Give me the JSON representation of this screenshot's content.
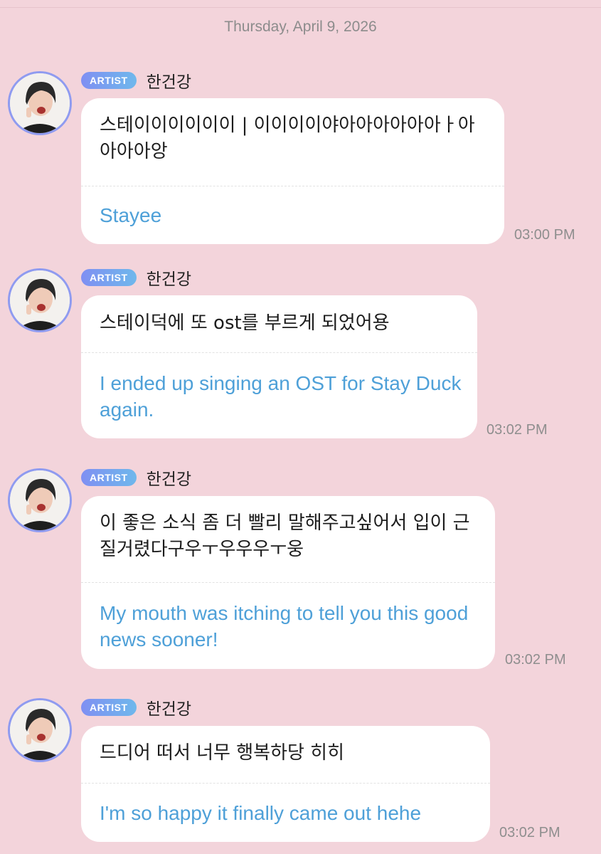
{
  "date_header": "Thursday, April 9, 2026",
  "messages": [
    {
      "badge": "ARTIST",
      "sender": "한건강",
      "original": "스테이이이이이이 | 이이이이야아아아아아아ㅏ아아아아앙",
      "translation": "Stayee",
      "time": "03:00 PM",
      "avatar_icon": "artist-avatar-icon"
    },
    {
      "badge": "ARTIST",
      "sender": "한건강",
      "original": "스테이덕에 또 ost를 부르게 되었어용",
      "translation": "I ended up singing an OST for Stay Duck again.",
      "time": "03:02 PM",
      "avatar_icon": "artist-avatar-icon"
    },
    {
      "badge": "ARTIST",
      "sender": "한건강",
      "original": " 이 좋은 소식 좀 더 빨리 말해주고싶어서 입이 근질거렸다구우ㅜ우우우ㅜ웅",
      "translation": "My mouth was itching to tell you this good news sooner!",
      "time": "03:02 PM",
      "avatar_icon": "artist-avatar-icon"
    },
    {
      "badge": "ARTIST",
      "sender": "한건강",
      "original": "드디어 떠서 너무 행복하당 히히",
      "translation": "I'm so happy it finally came out hehe",
      "time": "03:02 PM",
      "avatar_icon": "artist-avatar-icon"
    }
  ],
  "colors": {
    "background": "#f3d4db",
    "bubble": "#ffffff",
    "translation_text": "#4ea0d8",
    "badge_start": "#7f8ff2",
    "badge_end": "#6fb8ec",
    "avatar_ring": "#8f9bf0"
  }
}
